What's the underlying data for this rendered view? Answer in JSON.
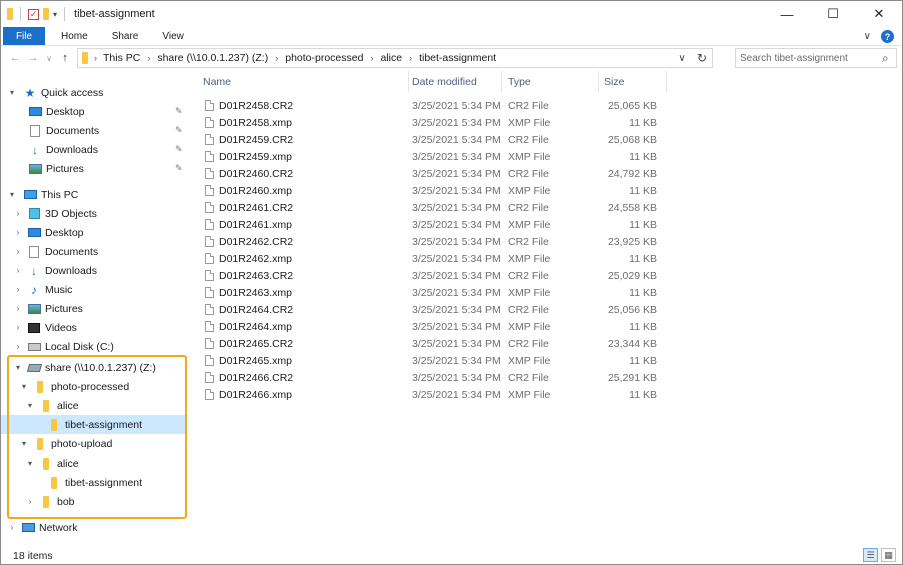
{
  "window": {
    "title": "tibet-assignment",
    "controls": {
      "minimize": "—",
      "maximize": "☐",
      "close": "✕"
    }
  },
  "ribbon": {
    "tabs": [
      "File",
      "Home",
      "Share",
      "View"
    ],
    "expand_icon": "∨",
    "help": "?"
  },
  "nav": {
    "back": "←",
    "forward": "→",
    "recent": "∨",
    "up": "↑",
    "breadcrumb": [
      "This PC",
      "share (\\\\10.0.1.237) (Z:)",
      "photo-processed",
      "alice",
      "tibet-assignment"
    ],
    "dropdown": "∨",
    "refresh": "↻"
  },
  "search": {
    "placeholder": "Search tibet-assignment",
    "icon": "⌕"
  },
  "navpane": {
    "items": [
      {
        "label": "Quick access",
        "icon": "star-icon",
        "arrow": "▾",
        "pinned": false
      },
      {
        "label": "Desktop",
        "icon": "desktop-icon",
        "arrow": "",
        "pinned": true
      },
      {
        "label": "Documents",
        "icon": "documents-icon",
        "arrow": "",
        "pinned": true
      },
      {
        "label": "Downloads",
        "icon": "downloads-icon",
        "arrow": "",
        "pinned": true
      },
      {
        "label": "Pictures",
        "icon": "pictures-icon",
        "arrow": "",
        "pinned": true
      },
      {
        "label": "This PC",
        "icon": "pc-icon",
        "arrow": "▾",
        "pinned": false
      },
      {
        "label": "3D Objects",
        "icon": "cube-icon",
        "arrow": "›",
        "pinned": false
      },
      {
        "label": "Desktop",
        "icon": "desktop-icon",
        "arrow": "›",
        "pinned": false
      },
      {
        "label": "Documents",
        "icon": "documents-icon",
        "arrow": "›",
        "pinned": false
      },
      {
        "label": "Downloads",
        "icon": "downloads-icon",
        "arrow": "›",
        "pinned": false
      },
      {
        "label": "Music",
        "icon": "music-icon",
        "arrow": "›",
        "pinned": false
      },
      {
        "label": "Pictures",
        "icon": "pictures-icon",
        "arrow": "›",
        "pinned": false
      },
      {
        "label": "Videos",
        "icon": "videos-icon",
        "arrow": "›",
        "pinned": false
      },
      {
        "label": "Local Disk (C:)",
        "icon": "disk-icon",
        "arrow": "›",
        "pinned": false
      },
      {
        "label": "share (\\\\10.0.1.237) (Z:)",
        "icon": "network-drive-icon",
        "arrow": "▾",
        "pinned": false
      },
      {
        "label": "photo-processed",
        "icon": "folder-icon",
        "arrow": "▾",
        "pinned": false
      },
      {
        "label": "alice",
        "icon": "folder-icon",
        "arrow": "▾",
        "pinned": false
      },
      {
        "label": "tibet-assignment",
        "icon": "folder-icon",
        "arrow": "",
        "pinned": false,
        "selected": true
      },
      {
        "label": "photo-upload",
        "icon": "folder-icon",
        "arrow": "▾",
        "pinned": false
      },
      {
        "label": "alice",
        "icon": "folder-icon",
        "arrow": "▾",
        "pinned": false
      },
      {
        "label": "tibet-assignment",
        "icon": "folder-icon",
        "arrow": "",
        "pinned": false
      },
      {
        "label": "bob",
        "icon": "folder-icon",
        "arrow": "›",
        "pinned": false
      },
      {
        "label": "Network",
        "icon": "network-icon",
        "arrow": "›",
        "pinned": false
      }
    ],
    "pin_glyph": "📌",
    "highlight_color": "#f2a81b"
  },
  "columns": {
    "name": "Name",
    "date": "Date modified",
    "type": "Type",
    "size": "Size"
  },
  "files": [
    {
      "name": "D01R2458.CR2",
      "date": "3/25/2021 5:34 PM",
      "type": "CR2 File",
      "size": "25,065 KB"
    },
    {
      "name": "D01R2458.xmp",
      "date": "3/25/2021 5:34 PM",
      "type": "XMP File",
      "size": "11 KB"
    },
    {
      "name": "D01R2459.CR2",
      "date": "3/25/2021 5:34 PM",
      "type": "CR2 File",
      "size": "25,068 KB"
    },
    {
      "name": "D01R2459.xmp",
      "date": "3/25/2021 5:34 PM",
      "type": "XMP File",
      "size": "11 KB"
    },
    {
      "name": "D01R2460.CR2",
      "date": "3/25/2021 5:34 PM",
      "type": "CR2 File",
      "size": "24,792 KB"
    },
    {
      "name": "D01R2460.xmp",
      "date": "3/25/2021 5:34 PM",
      "type": "XMP File",
      "size": "11 KB"
    },
    {
      "name": "D01R2461.CR2",
      "date": "3/25/2021 5:34 PM",
      "type": "CR2 File",
      "size": "24,558 KB"
    },
    {
      "name": "D01R2461.xmp",
      "date": "3/25/2021 5:34 PM",
      "type": "XMP File",
      "size": "11 KB"
    },
    {
      "name": "D01R2462.CR2",
      "date": "3/25/2021 5:34 PM",
      "type": "CR2 File",
      "size": "23,925 KB"
    },
    {
      "name": "D01R2462.xmp",
      "date": "3/25/2021 5:34 PM",
      "type": "XMP File",
      "size": "11 KB"
    },
    {
      "name": "D01R2463.CR2",
      "date": "3/25/2021 5:34 PM",
      "type": "CR2 File",
      "size": "25,029 KB"
    },
    {
      "name": "D01R2463.xmp",
      "date": "3/25/2021 5:34 PM",
      "type": "XMP File",
      "size": "11 KB"
    },
    {
      "name": "D01R2464.CR2",
      "date": "3/25/2021 5:34 PM",
      "type": "CR2 File",
      "size": "25,056 KB"
    },
    {
      "name": "D01R2464.xmp",
      "date": "3/25/2021 5:34 PM",
      "type": "XMP File",
      "size": "11 KB"
    },
    {
      "name": "D01R2465.CR2",
      "date": "3/25/2021 5:34 PM",
      "type": "CR2 File",
      "size": "23,344 KB"
    },
    {
      "name": "D01R2465.xmp",
      "date": "3/25/2021 5:34 PM",
      "type": "XMP File",
      "size": "11 KB"
    },
    {
      "name": "D01R2466.CR2",
      "date": "3/25/2021 5:34 PM",
      "type": "CR2 File",
      "size": "25,291 KB"
    },
    {
      "name": "D01R2466.xmp",
      "date": "3/25/2021 5:34 PM",
      "type": "XMP File",
      "size": "11 KB"
    }
  ],
  "status": {
    "count": "18 items"
  },
  "colors": {
    "accent": "#1a6fc9",
    "selection": "#cce8ff",
    "header_text": "#4c607a"
  }
}
